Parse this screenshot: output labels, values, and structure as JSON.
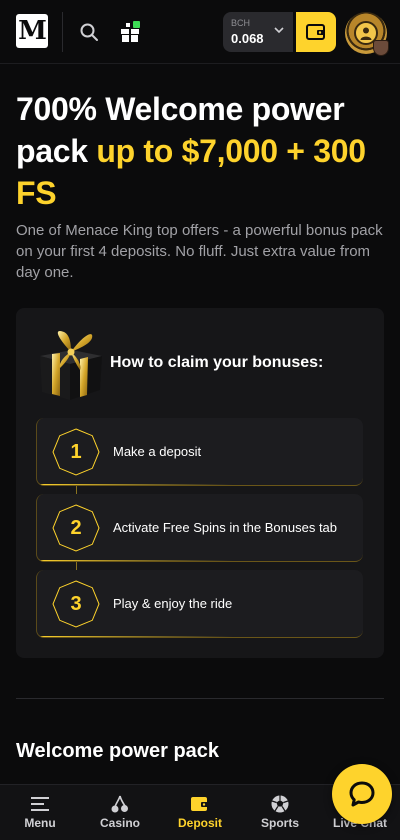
{
  "header": {
    "logo_text": "M",
    "balance": {
      "currency": "BCH",
      "amount": "0.068"
    },
    "colors": {
      "accent": "#fed32c",
      "notification_dot": "#3ddc54"
    }
  },
  "hero": {
    "title_white": "700% Welcome power pack ",
    "title_highlight": "up to $7,000 + 300 FS",
    "description": "One of Menace King top offers - a powerful bonus pack on your first 4 deposits. No fluff. Just extra value from day one."
  },
  "claim": {
    "title": "How to claim your bonuses:",
    "steps": [
      {
        "number": "1",
        "label": "Make a deposit"
      },
      {
        "number": "2",
        "label": "Activate Free Spins in the Bonuses tab"
      },
      {
        "number": "3",
        "label": "Play & enjoy the ride"
      }
    ]
  },
  "section": {
    "title": "Welcome power pack"
  },
  "bottom_nav": {
    "items": [
      {
        "label": "Menu",
        "icon": "menu-icon"
      },
      {
        "label": "Casino",
        "icon": "cherries-icon"
      },
      {
        "label": "Deposit",
        "icon": "wallet-icon",
        "active": true
      },
      {
        "label": "Sports",
        "icon": "soccer-ball-icon"
      },
      {
        "label": "Live Chat",
        "icon": "chat-icon"
      }
    ]
  }
}
